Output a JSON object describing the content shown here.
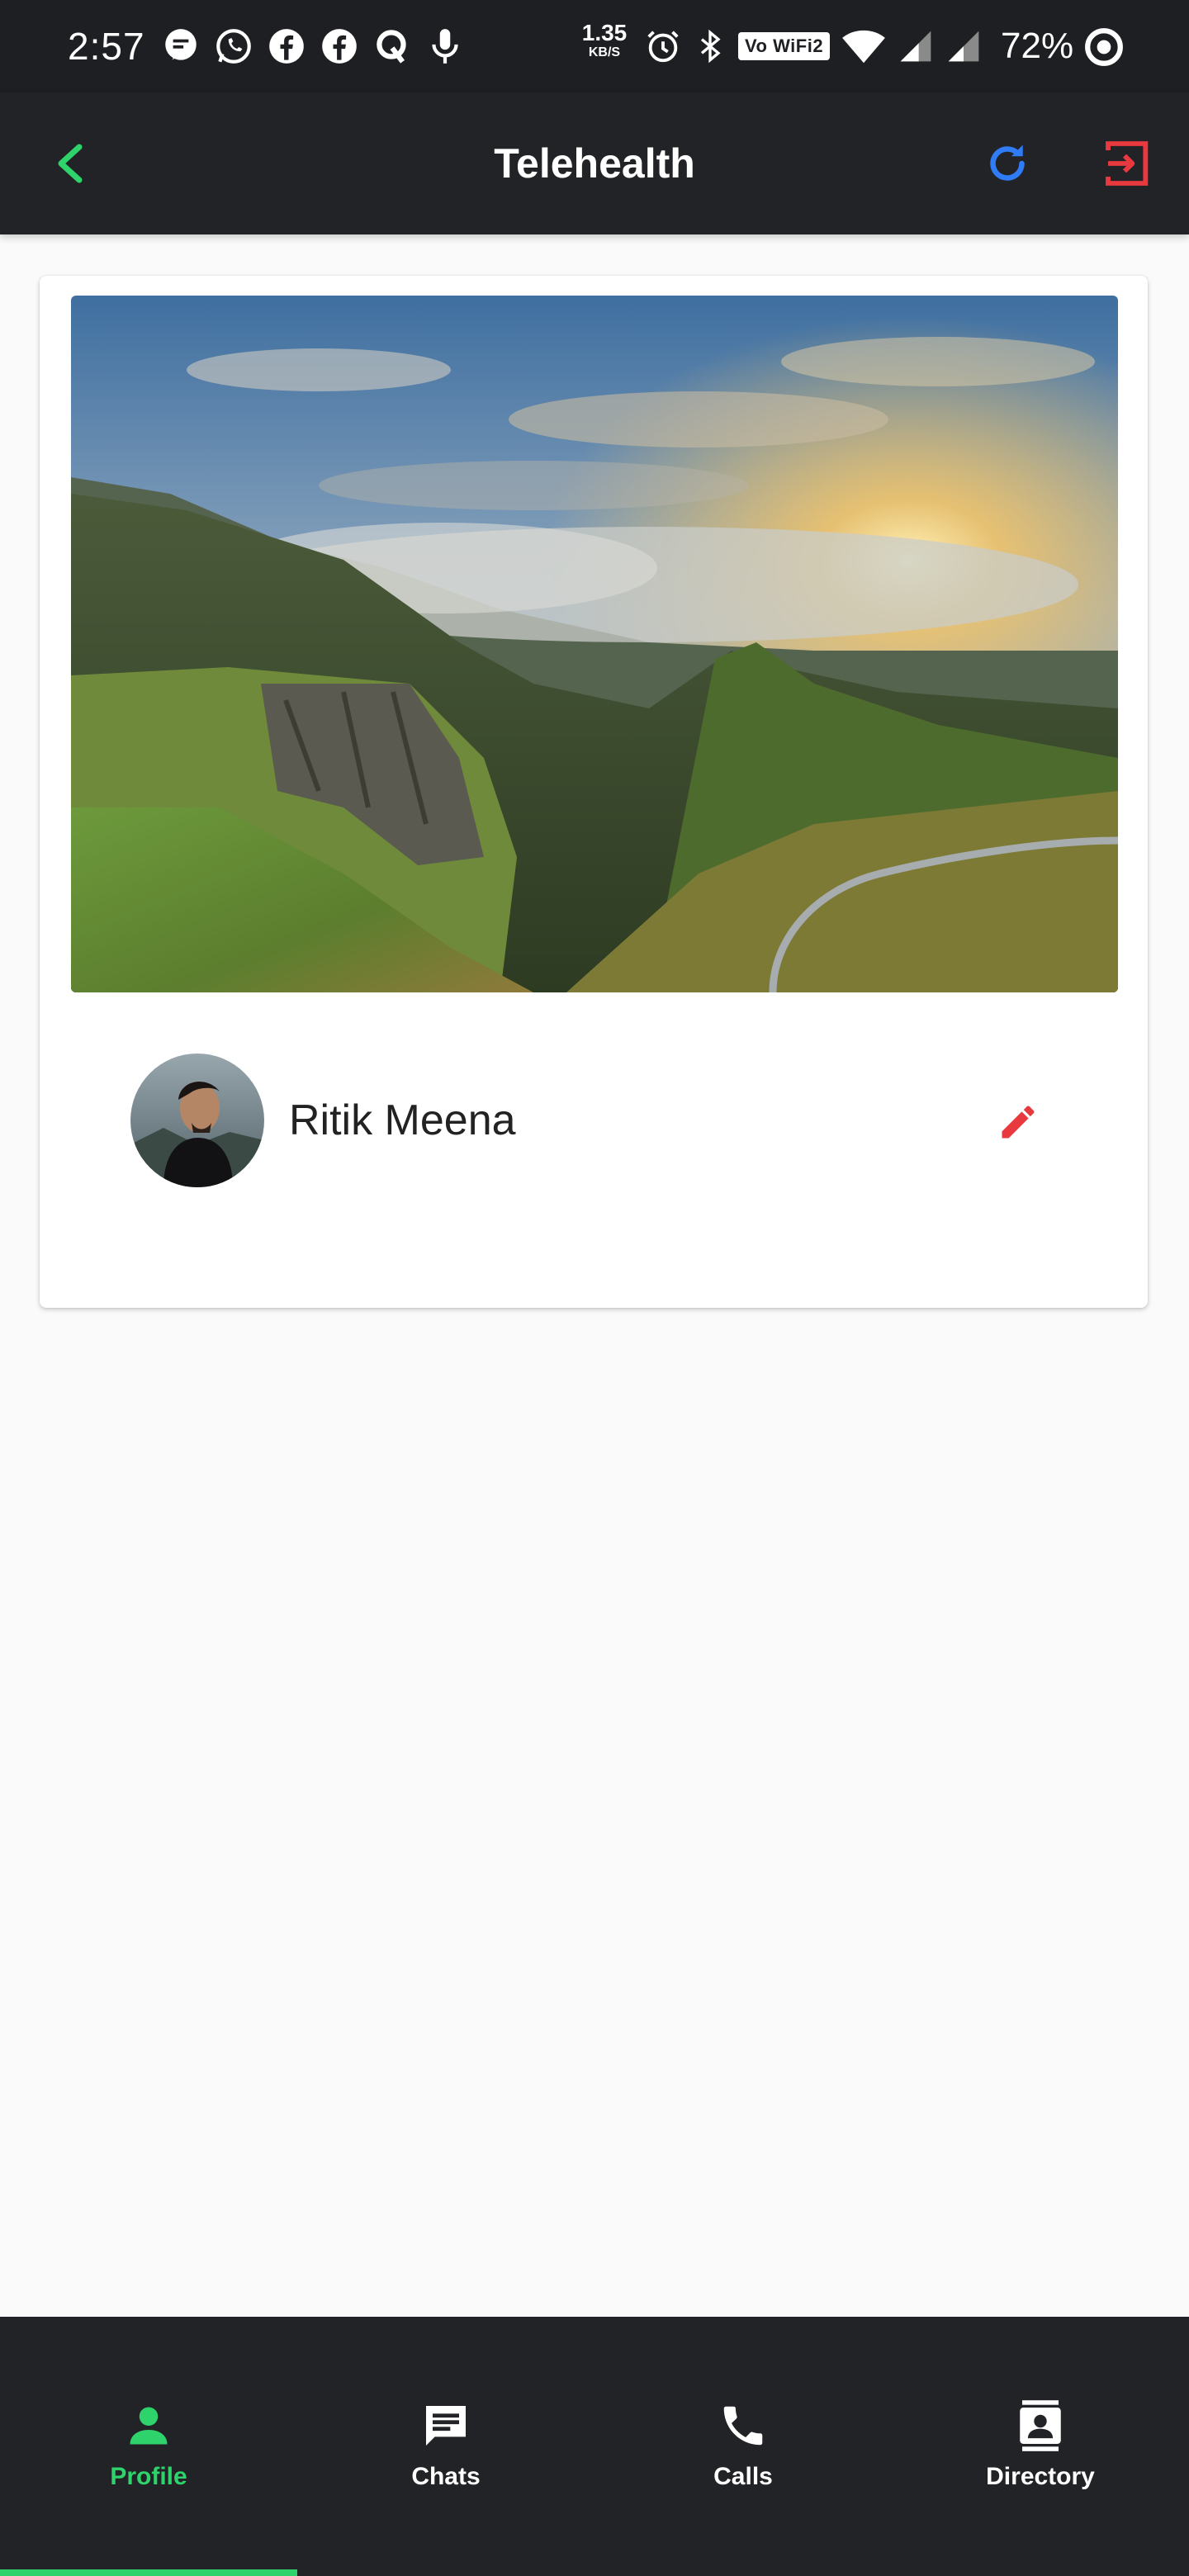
{
  "status_bar": {
    "time": "2:57",
    "net_speed_value": "1.35",
    "net_speed_unit": "KB/S",
    "wifi_label": "Vo WiFi2",
    "battery": "72%",
    "notification_icons": [
      "message-icon",
      "whatsapp-icon",
      "facebook-icon",
      "facebook-icon",
      "quora-icon",
      "microphone-icon"
    ],
    "system_icons": [
      "alarm-icon",
      "bluetooth-icon",
      "wifi-icon",
      "signal-icon",
      "signal-icon",
      "battery-ring-icon"
    ]
  },
  "app_bar": {
    "title": "Telehealth",
    "back_icon": "chevron-left-icon",
    "refresh_icon": "refresh-icon",
    "logout_icon": "logout-icon"
  },
  "profile": {
    "name": "Ritik Meena",
    "cover_image": "landscape-mountain-valley",
    "avatar": "user-avatar-photo",
    "edit_icon": "pencil-icon"
  },
  "bottom_nav": {
    "items": [
      {
        "label": "Profile",
        "icon": "person-icon",
        "active": true
      },
      {
        "label": "Chats",
        "icon": "chat-icon",
        "active": false
      },
      {
        "label": "Calls",
        "icon": "phone-icon",
        "active": false
      },
      {
        "label": "Directory",
        "icon": "contact-card-icon",
        "active": false
      }
    ]
  },
  "colors": {
    "accent_green": "#2fd36b",
    "refresh_blue": "#2f7cf6",
    "logout_red": "#e8393f",
    "edit_red": "#e8393f",
    "bar_background": "#222326",
    "page_background": "#fafafa"
  }
}
